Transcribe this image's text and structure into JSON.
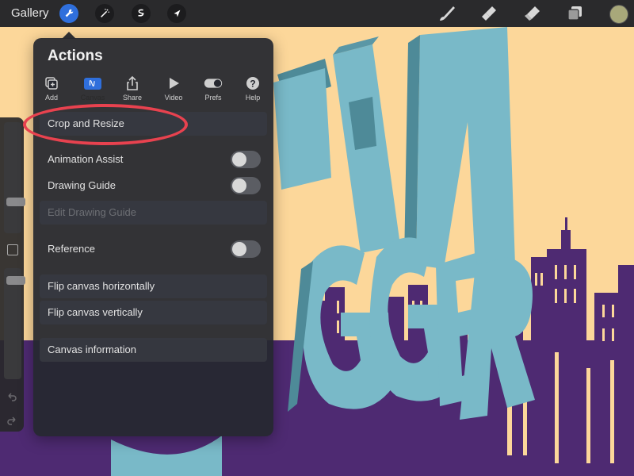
{
  "topbar": {
    "gallery_label": "Gallery"
  },
  "panel": {
    "title": "Actions",
    "tabs": [
      {
        "label": "Add"
      },
      {
        "label": "Canvas"
      },
      {
        "label": "Share"
      },
      {
        "label": "Video"
      },
      {
        "label": "Prefs"
      },
      {
        "label": "Help"
      }
    ],
    "rows": {
      "crop_resize": "Crop and Resize",
      "animation_assist": "Animation Assist",
      "drawing_guide": "Drawing Guide",
      "edit_drawing_guide": "Edit Drawing Guide",
      "reference": "Reference",
      "flip_horizontal": "Flip canvas horizontally",
      "flip_vertical": "Flip canvas vertically",
      "canvas_information": "Canvas information"
    },
    "toggles": {
      "animation_assist": false,
      "drawing_guide": false,
      "reference": false
    }
  },
  "colors": {
    "accent": "#2f6fdc",
    "highlight": "#e8424f",
    "canvas_background": "#fcd79a",
    "skyline": "#4e2a72",
    "letters": "#79b9c8",
    "current_color": "#a8a87a"
  },
  "icons": {
    "top_left_tools": [
      "wrench-icon",
      "magic-wand-icon",
      "selection-icon",
      "transform-arrow-icon"
    ],
    "top_right_tools": [
      "brush-icon",
      "smudge-icon",
      "eraser-icon",
      "layers-icon"
    ]
  }
}
